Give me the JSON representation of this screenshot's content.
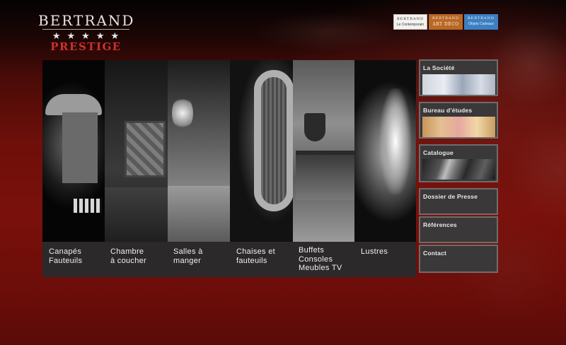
{
  "logo": {
    "top": "BERTRAND",
    "stars": "★★★★★",
    "bottom": "PRESTIGE"
  },
  "brands": [
    {
      "name": "BERTRAND",
      "sub": "Le Contemporain",
      "color": "#f4f2ef"
    },
    {
      "name": "BERTRAND",
      "sub": "ART DÉCO",
      "color": "#b96826"
    },
    {
      "name": "BERTRAND",
      "sub": "Objets Cadeaux",
      "color": "#3c7fc2"
    }
  ],
  "gallery": {
    "categories": [
      {
        "line1": "Canapés",
        "line2": "Fauteuils",
        "line3": ""
      },
      {
        "line1": "Chambre",
        "line2": "à coucher",
        "line3": ""
      },
      {
        "line1": "Salles à",
        "line2": "manger",
        "line3": ""
      },
      {
        "line1": "Chaises et",
        "line2": "fauteuils",
        "line3": ""
      },
      {
        "line1": "Buffets",
        "line2": "Consoles",
        "line3": "Meubles TV"
      },
      {
        "line1": "Lustres",
        "line2": "",
        "line3": ""
      }
    ]
  },
  "sidebar": {
    "items": [
      {
        "label": "La Société",
        "has_thumb": true
      },
      {
        "label": "Bureau d'études",
        "has_thumb": true
      },
      {
        "label": "Catalogue",
        "has_thumb": true
      },
      {
        "label": "Dossier de Presse",
        "has_thumb": false
      },
      {
        "label": "Références",
        "has_thumb": false
      },
      {
        "label": "Contact",
        "has_thumb": false
      }
    ]
  },
  "colors": {
    "accent_red": "#d0302a",
    "background_red": "#7a100b",
    "panel_gray": "#3a3838"
  }
}
